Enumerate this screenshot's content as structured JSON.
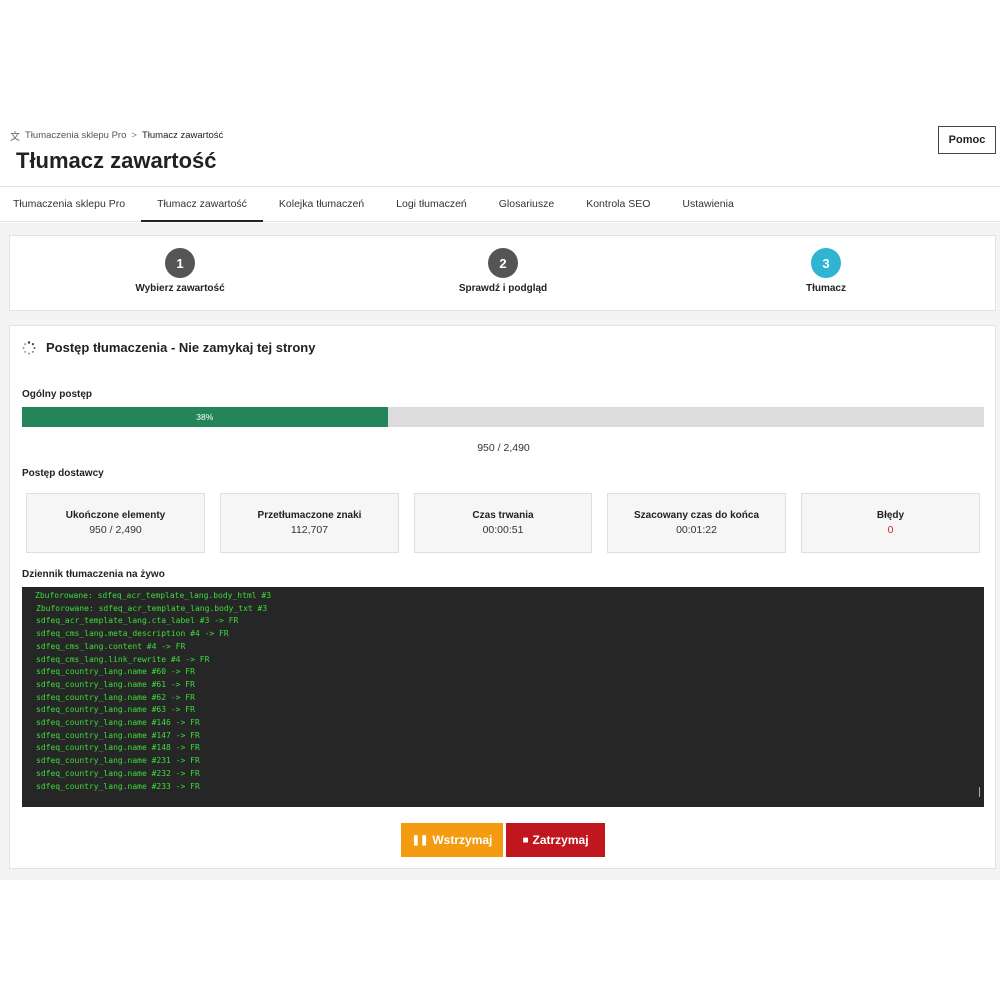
{
  "breadcrumb": {
    "root": "Tłumaczenia sklepu Pro",
    "current": "Tłumacz zawartość"
  },
  "page_title": "Tłumacz zawartość",
  "help_button": "Pomoc",
  "tabs": [
    {
      "label": "Tłumaczenia sklepu Pro",
      "active": false
    },
    {
      "label": "Tłumacz zawartość",
      "active": true
    },
    {
      "label": "Kolejka tłumaczeń",
      "active": false
    },
    {
      "label": "Logi tłumaczeń",
      "active": false
    },
    {
      "label": "Glosariusze",
      "active": false
    },
    {
      "label": "Kontrola SEO",
      "active": false
    },
    {
      "label": "Ustawienia",
      "active": false
    }
  ],
  "steps": [
    {
      "number": "1",
      "label": "Wybierz zawartość",
      "active": false
    },
    {
      "number": "2",
      "label": "Sprawdź i podgląd",
      "active": false
    },
    {
      "number": "3",
      "label": "Tłumacz",
      "active": true
    }
  ],
  "progress_panel": {
    "title": "Postęp tłumaczenia - Nie zamykaj tej strony",
    "overall_label": "Ogólny postęp",
    "percent_text": "38%",
    "percent_value": 38,
    "count": "950 / 2,490",
    "provider_label": "Postęp dostawcy"
  },
  "stats": [
    {
      "label": "Ukończone elementy",
      "value": "950 / 2,490"
    },
    {
      "label": "Przetłumaczone znaki",
      "value": "112,707"
    },
    {
      "label": "Czas trwania",
      "value": "00:00:51"
    },
    {
      "label": "Szacowany czas do końca",
      "value": "00:01:22"
    },
    {
      "label": "Błędy",
      "value": "0"
    }
  ],
  "log": {
    "label": "Dziennik tłumaczenia na żywo",
    "lines": [
      "Zbuforowane: sdfeq_acr_template_lang.body_html #3",
      "Zbuforowane: sdfeq_acr_template_lang.body_txt #3",
      "sdfeq_acr_template_lang.cta_label #3 -> FR",
      "sdfeq_cms_lang.meta_description #4 -> FR",
      "sdfeq_cms_lang.content #4 -> FR",
      "sdfeq_cms_lang.link_rewrite #4 -> FR",
      "sdfeq_country_lang.name #60 -> FR",
      "sdfeq_country_lang.name #61 -> FR",
      "sdfeq_country_lang.name #62 -> FR",
      "sdfeq_country_lang.name #63 -> FR",
      "sdfeq_country_lang.name #146 -> FR",
      "sdfeq_country_lang.name #147 -> FR",
      "sdfeq_country_lang.name #148 -> FR",
      "sdfeq_country_lang.name #231 -> FR",
      "sdfeq_country_lang.name #232 -> FR",
      "sdfeq_country_lang.name #233 -> FR"
    ]
  },
  "buttons": {
    "pause": "Wstrzymaj",
    "stop": "Zatrzymaj"
  },
  "colors": {
    "progress": "#25855a",
    "active_step": "#2fb5d2",
    "pause": "#f39c12",
    "stop": "#c0161e",
    "log_text": "#3ddc3d"
  }
}
